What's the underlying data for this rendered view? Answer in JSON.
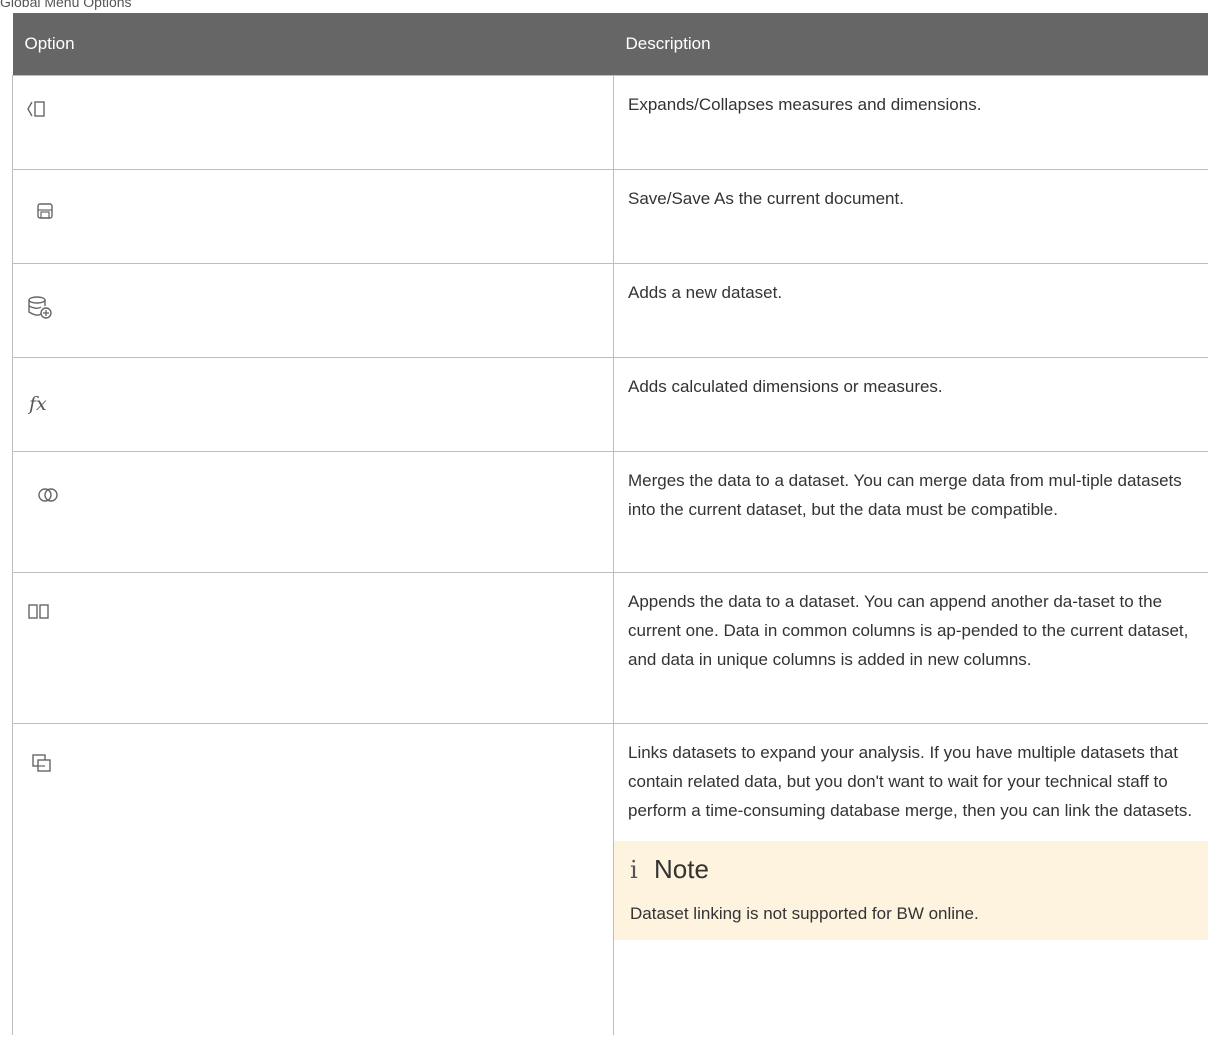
{
  "caption": "Global Menu Options",
  "headers": {
    "option": "Option",
    "description": "Description"
  },
  "rows": [
    {
      "icon": "collapse-panel-icon",
      "description": "Expands/Collapses measures and dimensions."
    },
    {
      "icon": "save-icon",
      "description": "Save/Save As the current document."
    },
    {
      "icon": "add-dataset-icon",
      "description": "Adds a new dataset."
    },
    {
      "icon": "formula-icon",
      "description": "Adds calculated dimensions or measures."
    },
    {
      "icon": "merge-icon",
      "description": "Merges the data to a dataset. You can merge data from mul-tiple datasets into the current dataset, but the data must be compatible."
    },
    {
      "icon": "append-icon",
      "description": "Appends the data to a dataset. You can append another da-taset to the current one. Data in common columns is ap-pended to the current dataset, and data in unique columns is added in new columns."
    },
    {
      "icon": "link-datasets-icon",
      "description": "Links datasets to expand your analysis. If you have multiple datasets that contain related data, but you don't want to wait for your technical staff to perform a time-consuming database merge, then you can link the datasets."
    }
  ],
  "note": {
    "icon_glyph": "i",
    "title": "Note",
    "text": "Dataset linking is not supported for BW online."
  }
}
